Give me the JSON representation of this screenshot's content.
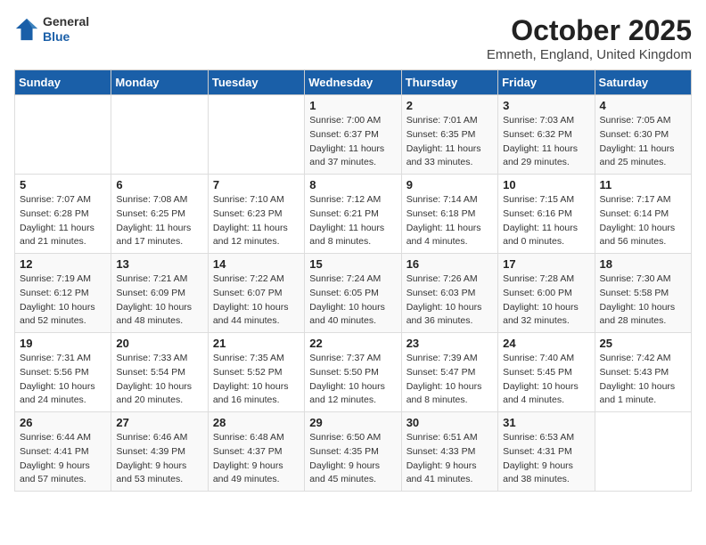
{
  "header": {
    "logo_general": "General",
    "logo_blue": "Blue",
    "title": "October 2025",
    "subtitle": "Emneth, England, United Kingdom"
  },
  "days_of_week": [
    "Sunday",
    "Monday",
    "Tuesday",
    "Wednesday",
    "Thursday",
    "Friday",
    "Saturday"
  ],
  "weeks": [
    [
      {
        "day": "",
        "info": ""
      },
      {
        "day": "",
        "info": ""
      },
      {
        "day": "",
        "info": ""
      },
      {
        "day": "1",
        "info": "Sunrise: 7:00 AM\nSunset: 6:37 PM\nDaylight: 11 hours\nand 37 minutes."
      },
      {
        "day": "2",
        "info": "Sunrise: 7:01 AM\nSunset: 6:35 PM\nDaylight: 11 hours\nand 33 minutes."
      },
      {
        "day": "3",
        "info": "Sunrise: 7:03 AM\nSunset: 6:32 PM\nDaylight: 11 hours\nand 29 minutes."
      },
      {
        "day": "4",
        "info": "Sunrise: 7:05 AM\nSunset: 6:30 PM\nDaylight: 11 hours\nand 25 minutes."
      }
    ],
    [
      {
        "day": "5",
        "info": "Sunrise: 7:07 AM\nSunset: 6:28 PM\nDaylight: 11 hours\nand 21 minutes."
      },
      {
        "day": "6",
        "info": "Sunrise: 7:08 AM\nSunset: 6:25 PM\nDaylight: 11 hours\nand 17 minutes."
      },
      {
        "day": "7",
        "info": "Sunrise: 7:10 AM\nSunset: 6:23 PM\nDaylight: 11 hours\nand 12 minutes."
      },
      {
        "day": "8",
        "info": "Sunrise: 7:12 AM\nSunset: 6:21 PM\nDaylight: 11 hours\nand 8 minutes."
      },
      {
        "day": "9",
        "info": "Sunrise: 7:14 AM\nSunset: 6:18 PM\nDaylight: 11 hours\nand 4 minutes."
      },
      {
        "day": "10",
        "info": "Sunrise: 7:15 AM\nSunset: 6:16 PM\nDaylight: 11 hours\nand 0 minutes."
      },
      {
        "day": "11",
        "info": "Sunrise: 7:17 AM\nSunset: 6:14 PM\nDaylight: 10 hours\nand 56 minutes."
      }
    ],
    [
      {
        "day": "12",
        "info": "Sunrise: 7:19 AM\nSunset: 6:12 PM\nDaylight: 10 hours\nand 52 minutes."
      },
      {
        "day": "13",
        "info": "Sunrise: 7:21 AM\nSunset: 6:09 PM\nDaylight: 10 hours\nand 48 minutes."
      },
      {
        "day": "14",
        "info": "Sunrise: 7:22 AM\nSunset: 6:07 PM\nDaylight: 10 hours\nand 44 minutes."
      },
      {
        "day": "15",
        "info": "Sunrise: 7:24 AM\nSunset: 6:05 PM\nDaylight: 10 hours\nand 40 minutes."
      },
      {
        "day": "16",
        "info": "Sunrise: 7:26 AM\nSunset: 6:03 PM\nDaylight: 10 hours\nand 36 minutes."
      },
      {
        "day": "17",
        "info": "Sunrise: 7:28 AM\nSunset: 6:00 PM\nDaylight: 10 hours\nand 32 minutes."
      },
      {
        "day": "18",
        "info": "Sunrise: 7:30 AM\nSunset: 5:58 PM\nDaylight: 10 hours\nand 28 minutes."
      }
    ],
    [
      {
        "day": "19",
        "info": "Sunrise: 7:31 AM\nSunset: 5:56 PM\nDaylight: 10 hours\nand 24 minutes."
      },
      {
        "day": "20",
        "info": "Sunrise: 7:33 AM\nSunset: 5:54 PM\nDaylight: 10 hours\nand 20 minutes."
      },
      {
        "day": "21",
        "info": "Sunrise: 7:35 AM\nSunset: 5:52 PM\nDaylight: 10 hours\nand 16 minutes."
      },
      {
        "day": "22",
        "info": "Sunrise: 7:37 AM\nSunset: 5:50 PM\nDaylight: 10 hours\nand 12 minutes."
      },
      {
        "day": "23",
        "info": "Sunrise: 7:39 AM\nSunset: 5:47 PM\nDaylight: 10 hours\nand 8 minutes."
      },
      {
        "day": "24",
        "info": "Sunrise: 7:40 AM\nSunset: 5:45 PM\nDaylight: 10 hours\nand 4 minutes."
      },
      {
        "day": "25",
        "info": "Sunrise: 7:42 AM\nSunset: 5:43 PM\nDaylight: 10 hours\nand 1 minute."
      }
    ],
    [
      {
        "day": "26",
        "info": "Sunrise: 6:44 AM\nSunset: 4:41 PM\nDaylight: 9 hours\nand 57 minutes."
      },
      {
        "day": "27",
        "info": "Sunrise: 6:46 AM\nSunset: 4:39 PM\nDaylight: 9 hours\nand 53 minutes."
      },
      {
        "day": "28",
        "info": "Sunrise: 6:48 AM\nSunset: 4:37 PM\nDaylight: 9 hours\nand 49 minutes."
      },
      {
        "day": "29",
        "info": "Sunrise: 6:50 AM\nSunset: 4:35 PM\nDaylight: 9 hours\nand 45 minutes."
      },
      {
        "day": "30",
        "info": "Sunrise: 6:51 AM\nSunset: 4:33 PM\nDaylight: 9 hours\nand 41 minutes."
      },
      {
        "day": "31",
        "info": "Sunrise: 6:53 AM\nSunset: 4:31 PM\nDaylight: 9 hours\nand 38 minutes."
      },
      {
        "day": "",
        "info": ""
      }
    ]
  ]
}
